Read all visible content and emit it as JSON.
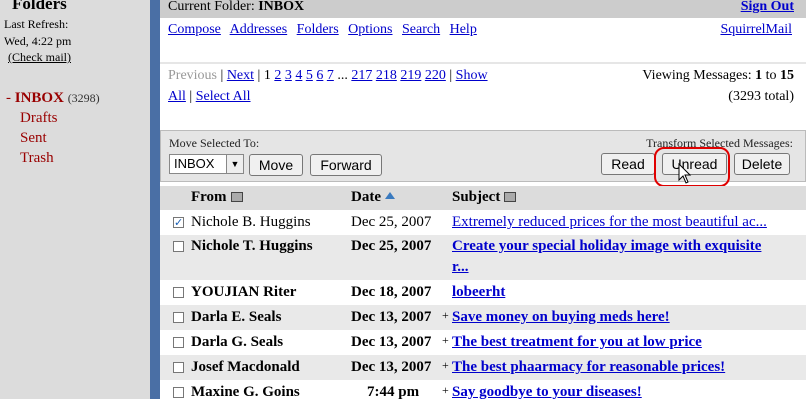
{
  "left": {
    "title": "Folders",
    "last_refresh_label": "Last Refresh:",
    "last_refresh_time": "Wed, 4:22 pm",
    "check_mail": "(Check mail)",
    "folders": [
      {
        "name": "INBOX",
        "count": "(3298)",
        "current": true
      },
      {
        "name": "Drafts"
      },
      {
        "name": "Sent"
      },
      {
        "name": "Trash"
      }
    ]
  },
  "header": {
    "current_folder_label": "Current Folder:",
    "current_folder": "INBOX",
    "sign_out": "Sign Out"
  },
  "nav": {
    "links": [
      "Compose",
      "Addresses",
      "Folders",
      "Options",
      "Search",
      "Help"
    ],
    "brand": "SquirrelMail"
  },
  "pager": {
    "previous": "Previous",
    "next": "Next",
    "pages": [
      "1",
      "2",
      "3",
      "4",
      "5",
      "6",
      "7",
      "...",
      "217",
      "218",
      "219",
      "220"
    ],
    "show": "Show",
    "all": "All",
    "select_all": "Select All",
    "viewing_prefix": "Viewing Messages:",
    "viewing_from": "1",
    "viewing_to_word": "to",
    "viewing_to": "15",
    "total": "(3293 total)"
  },
  "actions": {
    "move_label": "Move Selected To:",
    "move_folder": "INBOX",
    "move_button": "Move",
    "forward_button": "Forward",
    "transform_label": "Transform Selected Messages:",
    "read_button": "Read",
    "unread_button": "Unread",
    "delete_button": "Delete",
    "highlight_color": "#e00000"
  },
  "table": {
    "headers": {
      "from": "From",
      "date": "Date",
      "subject": "Subject"
    },
    "rows": [
      {
        "checked": true,
        "bold": false,
        "from": "Nichole B. Huggins",
        "date": "Dec 25, 2007",
        "plus": "",
        "subject": "Extremely reduced prices for the most beautiful ac..."
      },
      {
        "checked": false,
        "bold": true,
        "from": "Nichole T. Huggins",
        "date": "Dec 25, 2007",
        "plus": "",
        "subject": "Create your special holiday image with exquisite",
        "subject2": "r..."
      },
      {
        "checked": false,
        "bold": true,
        "from": "YOUJIAN Riter",
        "date": "Dec 18, 2007",
        "plus": "",
        "subject": "lobeerht"
      },
      {
        "checked": false,
        "bold": true,
        "from": "Darla E. Seals",
        "date": "Dec 13, 2007",
        "plus": "+",
        "subject": "Save money on buying meds here!"
      },
      {
        "checked": false,
        "bold": true,
        "from": "Darla G. Seals",
        "date": "Dec 13, 2007",
        "plus": "+",
        "subject": "The best treatment for you at low price"
      },
      {
        "checked": false,
        "bold": true,
        "from": "Josef Macdonald",
        "date": "Dec 13, 2007",
        "plus": "+",
        "subject": "The best phaarmacy for reasonable prices!"
      },
      {
        "checked": false,
        "bold": true,
        "from": "Maxine G. Goins",
        "date": "7:44 pm",
        "plus": "+",
        "subject": "Say goodbye to your diseases!"
      }
    ]
  }
}
